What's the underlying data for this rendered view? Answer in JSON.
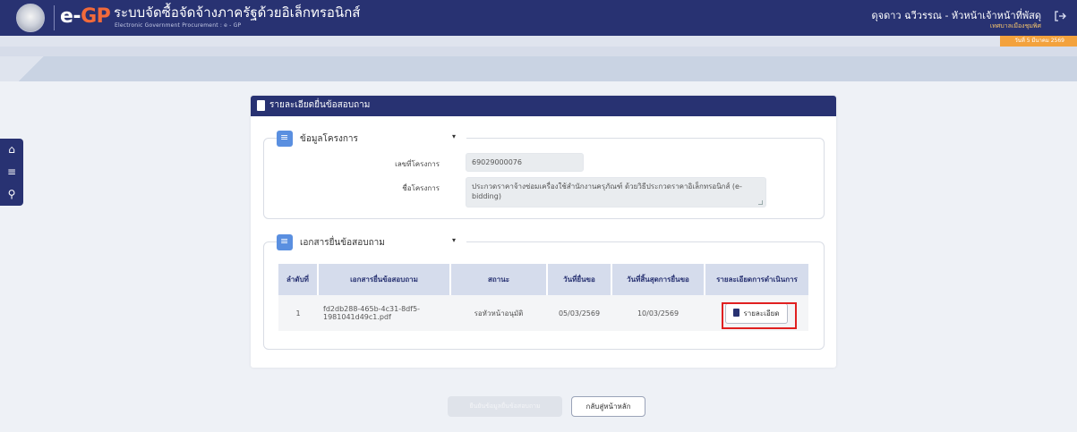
{
  "header": {
    "brand_e": "e-",
    "brand_gp": "GP",
    "system_title": "ระบบจัดซื้อจัดจ้างภาครัฐด้วยอิเล็กทรอนิกส์",
    "system_subtitle": "Electronic Government Procurement : e - GP",
    "user_name": "ดุจดาว ฉวีวรรณ - หัวหน้าเจ้าหน้าที่พัสดุ",
    "user_role": "เทศบาลเมืองชุมพิศ",
    "logout_icon": "logout-icon",
    "date_text": "วันที่ 5 มีนาคม 2569"
  },
  "sidemenu": {
    "items": [
      {
        "icon": "home-icon",
        "glyph": "⌂"
      },
      {
        "icon": "menu-icon",
        "glyph": "≡"
      },
      {
        "icon": "search-icon",
        "glyph": "⚲"
      }
    ]
  },
  "card": {
    "title": "รายละเอียดยื่นข้อสอบถาม",
    "project_section": {
      "legend": "ข้อมูลโครงการ",
      "chevron": "▾",
      "project_no_label": "เลขที่โครงการ",
      "project_no_value": "69029000076",
      "project_name_label": "ชื่อโครงการ",
      "project_name_value": "ประกวดราคาจ้างซ่อมเครื่องใช้สำนักงานครุภัณฑ์ ด้วยวิธีประกวดราคาอิเล็กทรอนิกส์ (e-bidding)"
    },
    "docs_section": {
      "legend": "เอกสารยื่นข้อสอบถาม",
      "chevron": "▾",
      "columns": [
        "ลำดับที่",
        "เอกสารยื่นข้อสอบถาม",
        "สถานะ",
        "วันที่ยื่นขอ",
        "วันที่สิ้นสุดการยื่นขอ",
        "รายละเอียดการดำเนินการ"
      ],
      "rows": [
        {
          "no": "1",
          "file": "fd2db288-465b-4c31-8df5-1981041d49c1.pdf",
          "status": "รอหัวหน้าอนุมัติ",
          "submit_date": "05/03/2569",
          "end_date": "10/03/2569",
          "action_label": "รายละเอียด"
        }
      ]
    }
  },
  "buttons": {
    "disabled_label": "ยืนยันข้อมูลยื่นข้อสอบถาม",
    "home_label": "กลับสู่หน้าหลัก"
  }
}
